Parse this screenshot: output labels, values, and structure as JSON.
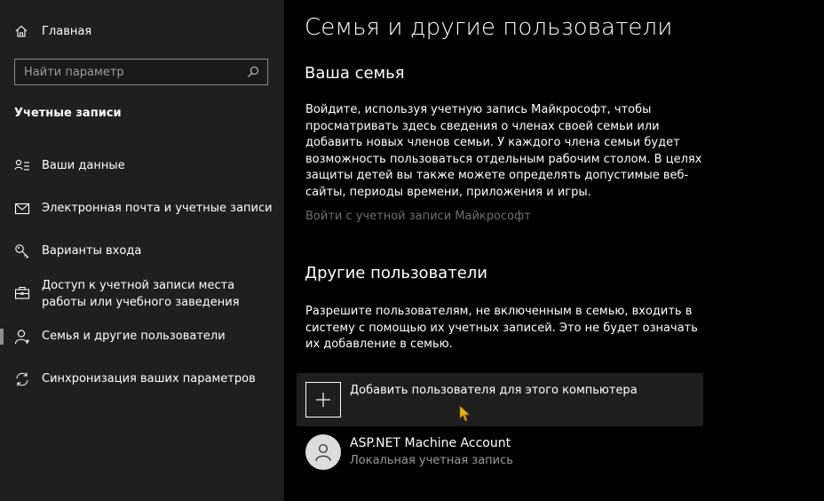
{
  "sidebar": {
    "home_label": "Главная",
    "search_placeholder": "Найти параметр",
    "section_title": "Учетные записи",
    "items": [
      {
        "label": "Ваши данные",
        "icon": "person-card-icon"
      },
      {
        "label": "Электронная почта и учетные записи",
        "icon": "mail-icon"
      },
      {
        "label": "Варианты входа",
        "icon": "key-icon"
      },
      {
        "label": "Доступ к учетной записи места работы или учебного заведения",
        "icon": "briefcase-icon"
      },
      {
        "label": "Семья и другие пользователи",
        "icon": "person-icon",
        "selected": true
      },
      {
        "label": "Синхронизация ваших параметров",
        "icon": "sync-icon"
      }
    ]
  },
  "main": {
    "title": "Семья и другие пользователи",
    "family": {
      "heading": "Ваша семья",
      "description": "Войдите, используя учетную запись Майкрософт, чтобы просматривать здесь сведения о членах своей семьи или добавить новых членов семьи. У каждого члена семьи будет возможность пользоваться отдельным рабочим столом. В целях защиты детей вы также можете определять допустимые веб-сайты, периоды времени, приложения и игры.",
      "link": "Войти с учетной записи Майкрософт"
    },
    "others": {
      "heading": "Другие пользователи",
      "description": "Разрешите пользователям, не включенным в семью, входить в систему с помощью их учетных записей. Это не будет означать их добавление в семью.",
      "add_label": "Добавить пользователя для этого компьютера",
      "user_name": "ASP.NET Machine Account",
      "user_type": "Локальная учетная запись"
    }
  },
  "colors": {
    "sidebar_bg": "#1f1f1f",
    "main_bg": "#000000",
    "link": "#6e6e6e",
    "cursor": "#e8b400"
  }
}
